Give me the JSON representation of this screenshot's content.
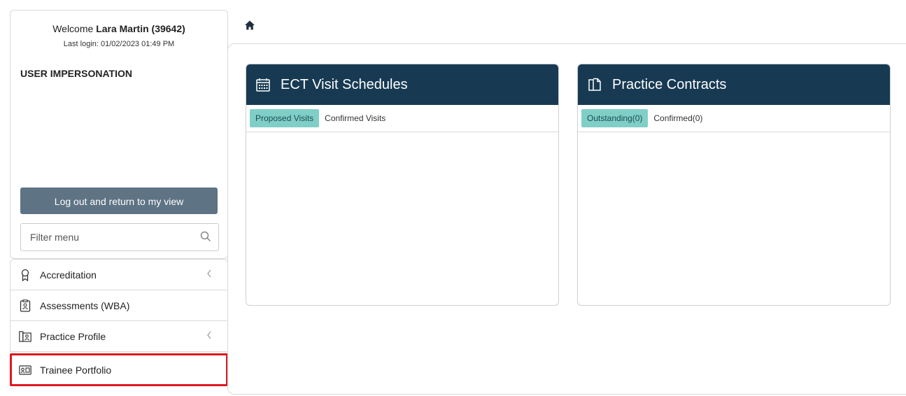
{
  "user": {
    "welcome_prefix": "Welcome",
    "name": "Lara Martin (39642)",
    "last_login": "Last login: 01/02/2023 01:49 PM"
  },
  "impersonation": {
    "heading": "USER IMPERSONATION",
    "logout_label": "Log out and return to my view"
  },
  "filter": {
    "placeholder": "Filter menu",
    "value": ""
  },
  "menu": {
    "items": [
      {
        "label": "Accreditation",
        "icon": "award-icon",
        "has_submenu": true
      },
      {
        "label": "Assessments (WBA)",
        "icon": "clipboard-user-icon",
        "has_submenu": false
      },
      {
        "label": "Practice Profile",
        "icon": "practice-profile-icon",
        "has_submenu": true
      },
      {
        "label": "Trainee Portfolio",
        "icon": "id-card-icon",
        "has_submenu": false,
        "highlighted": true
      }
    ]
  },
  "cards": [
    {
      "title": "ECT Visit Schedules",
      "icon": "calendar-icon",
      "tabs": [
        {
          "label": "Proposed Visits",
          "active": true
        },
        {
          "label": "Confirmed Visits",
          "active": false
        }
      ]
    },
    {
      "title": "Practice Contracts",
      "icon": "documents-icon",
      "tabs": [
        {
          "label": "Outstanding(0)",
          "active": true
        },
        {
          "label": "Confirmed(0)",
          "active": false
        }
      ]
    }
  ],
  "colors": {
    "card_header": "#173a52",
    "active_tab": "#7fcfc7",
    "logout_button": "#5e7384",
    "highlight_border": "#e0181f"
  }
}
